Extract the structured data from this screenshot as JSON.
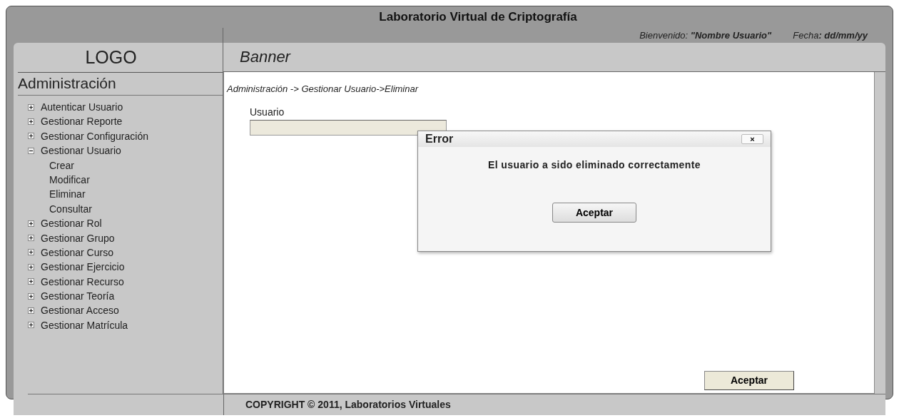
{
  "header": {
    "title": "Laboratorio Virtual de Criptografía",
    "welcome": "Bienvenido: **\"Nombre Usuario\"**",
    "date": "Fecha**: dd/mm/yy**"
  },
  "logo": "LOGO",
  "banner": "Banner",
  "sidebar": {
    "title": "Administración",
    "items": [
      {
        "label": "Autenticar Usuario",
        "expanded": false
      },
      {
        "label": "Gestionar Reporte",
        "expanded": false
      },
      {
        "label": "Gestionar Configuración",
        "expanded": false
      },
      {
        "label": "Gestionar Usuario",
        "expanded": true,
        "children": [
          {
            "label": "Crear"
          },
          {
            "label": "Modificar"
          },
          {
            "label": "Eliminar"
          },
          {
            "label": "Consultar"
          }
        ]
      },
      {
        "label": "Gestionar Rol",
        "expanded": false
      },
      {
        "label": "Gestionar Grupo",
        "expanded": false
      },
      {
        "label": "Gestionar Curso",
        "expanded": false
      },
      {
        "label": "Gestionar Ejercicio",
        "expanded": false
      },
      {
        "label": "Gestionar Recurso",
        "expanded": false
      },
      {
        "label": "Gestionar Teoría",
        "expanded": false
      },
      {
        "label": "Gestionar Acceso",
        "expanded": false
      },
      {
        "label": "Gestionar Matrícula",
        "expanded": false
      }
    ]
  },
  "breadcrumb": "Administración ->  Gestionar Usuario->Eliminar",
  "form": {
    "field_label": "Usuario",
    "submit": "Aceptar"
  },
  "dialog": {
    "title": "Error",
    "close": "×",
    "message": "El usuario a sido eliminado correctamente",
    "button": "Aceptar"
  },
  "footer": "COPYRIGHT © 2011, Laboratorios Virtuales"
}
